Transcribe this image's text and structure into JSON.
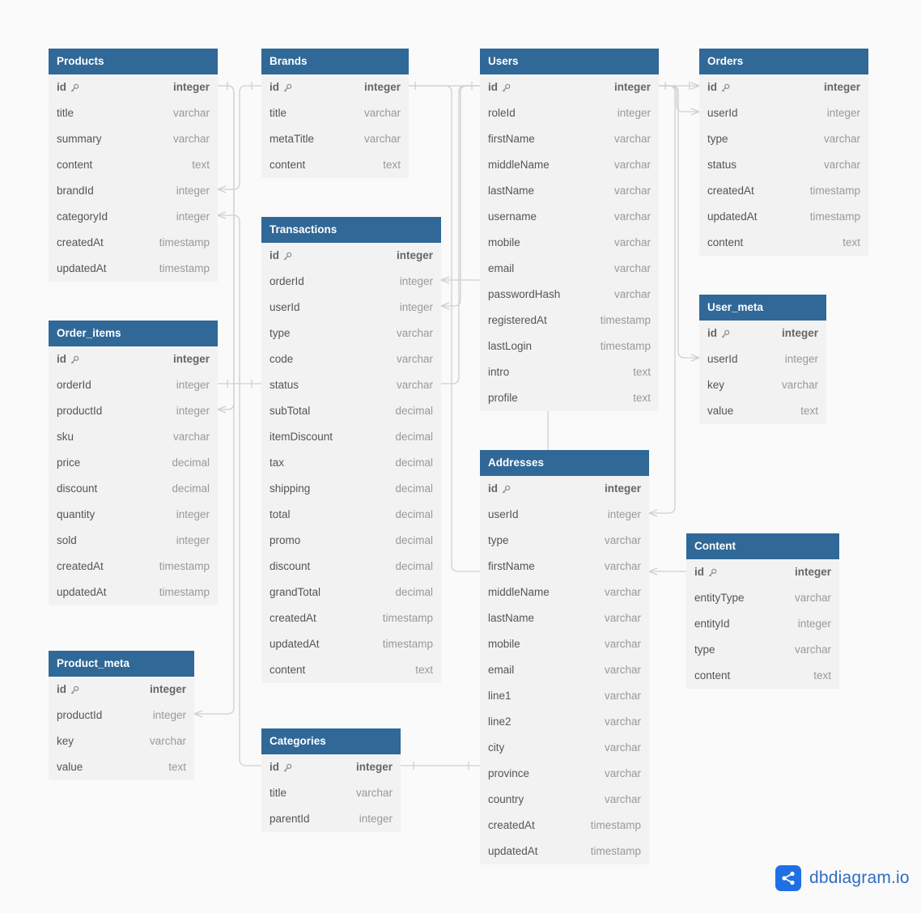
{
  "brand": {
    "name": "dbdiagram.io",
    "icon": "share-nodes-icon",
    "color": "#1f6fe5"
  },
  "colors": {
    "header": "#306897",
    "body": "#f2f2f2",
    "link": "#cfcfcf"
  },
  "tables": [
    {
      "id": "products",
      "name": "Products",
      "fields": [
        {
          "name": "id",
          "type": "integer",
          "pk": true
        },
        {
          "name": "title",
          "type": "varchar"
        },
        {
          "name": "summary",
          "type": "varchar"
        },
        {
          "name": "content",
          "type": "text"
        },
        {
          "name": "brandId",
          "type": "integer"
        },
        {
          "name": "categoryId",
          "type": "integer"
        },
        {
          "name": "createdAt",
          "type": "timestamp"
        },
        {
          "name": "updatedAt",
          "type": "timestamp"
        }
      ]
    },
    {
      "id": "brands",
      "name": "Brands",
      "fields": [
        {
          "name": "id",
          "type": "integer",
          "pk": true
        },
        {
          "name": "title",
          "type": "varchar"
        },
        {
          "name": "metaTitle",
          "type": "varchar"
        },
        {
          "name": "content",
          "type": "text"
        }
      ]
    },
    {
      "id": "users",
      "name": "Users",
      "fields": [
        {
          "name": "id",
          "type": "integer",
          "pk": true
        },
        {
          "name": "roleId",
          "type": "integer"
        },
        {
          "name": "firstName",
          "type": "varchar"
        },
        {
          "name": "middleName",
          "type": "varchar"
        },
        {
          "name": "lastName",
          "type": "varchar"
        },
        {
          "name": "username",
          "type": "varchar"
        },
        {
          "name": "mobile",
          "type": "varchar"
        },
        {
          "name": "email",
          "type": "varchar"
        },
        {
          "name": "passwordHash",
          "type": "varchar"
        },
        {
          "name": "registeredAt",
          "type": "timestamp"
        },
        {
          "name": "lastLogin",
          "type": "timestamp"
        },
        {
          "name": "intro",
          "type": "text"
        },
        {
          "name": "profile",
          "type": "text"
        }
      ]
    },
    {
      "id": "orders",
      "name": "Orders",
      "fields": [
        {
          "name": "id",
          "type": "integer",
          "pk": true
        },
        {
          "name": "userId",
          "type": "integer"
        },
        {
          "name": "type",
          "type": "varchar"
        },
        {
          "name": "status",
          "type": "varchar"
        },
        {
          "name": "createdAt",
          "type": "timestamp"
        },
        {
          "name": "updatedAt",
          "type": "timestamp"
        },
        {
          "name": "content",
          "type": "text"
        }
      ]
    },
    {
      "id": "transactions",
      "name": "Transactions",
      "fields": [
        {
          "name": "id",
          "type": "integer",
          "pk": true
        },
        {
          "name": "orderId",
          "type": "integer"
        },
        {
          "name": "userId",
          "type": "integer"
        },
        {
          "name": "type",
          "type": "varchar"
        },
        {
          "name": "code",
          "type": "varchar"
        },
        {
          "name": "status",
          "type": "varchar"
        },
        {
          "name": "subTotal",
          "type": "decimal"
        },
        {
          "name": "itemDiscount",
          "type": "decimal"
        },
        {
          "name": "tax",
          "type": "decimal"
        },
        {
          "name": "shipping",
          "type": "decimal"
        },
        {
          "name": "total",
          "type": "decimal"
        },
        {
          "name": "promo",
          "type": "decimal"
        },
        {
          "name": "discount",
          "type": "decimal"
        },
        {
          "name": "grandTotal",
          "type": "decimal"
        },
        {
          "name": "createdAt",
          "type": "timestamp"
        },
        {
          "name": "updatedAt",
          "type": "timestamp"
        },
        {
          "name": "content",
          "type": "text"
        }
      ]
    },
    {
      "id": "user_meta",
      "name": "User_meta",
      "fields": [
        {
          "name": "id",
          "type": "integer",
          "pk": true
        },
        {
          "name": "userId",
          "type": "integer"
        },
        {
          "name": "key",
          "type": "varchar"
        },
        {
          "name": "value",
          "type": "text"
        }
      ]
    },
    {
      "id": "order_items",
      "name": "Order_items",
      "fields": [
        {
          "name": "id",
          "type": "integer",
          "pk": true
        },
        {
          "name": "orderId",
          "type": "integer"
        },
        {
          "name": "productId",
          "type": "integer"
        },
        {
          "name": "sku",
          "type": "varchar"
        },
        {
          "name": "price",
          "type": "decimal"
        },
        {
          "name": "discount",
          "type": "decimal"
        },
        {
          "name": "quantity",
          "type": "integer"
        },
        {
          "name": "sold",
          "type": "integer"
        },
        {
          "name": "createdAt",
          "type": "timestamp"
        },
        {
          "name": "updatedAt",
          "type": "timestamp"
        }
      ]
    },
    {
      "id": "addresses",
      "name": "Addresses",
      "fields": [
        {
          "name": "id",
          "type": "integer",
          "pk": true
        },
        {
          "name": "userId",
          "type": "integer"
        },
        {
          "name": "type",
          "type": "varchar"
        },
        {
          "name": "firstName",
          "type": "varchar"
        },
        {
          "name": "middleName",
          "type": "varchar"
        },
        {
          "name": "lastName",
          "type": "varchar"
        },
        {
          "name": "mobile",
          "type": "varchar"
        },
        {
          "name": "email",
          "type": "varchar"
        },
        {
          "name": "line1",
          "type": "varchar"
        },
        {
          "name": "line2",
          "type": "varchar"
        },
        {
          "name": "city",
          "type": "varchar"
        },
        {
          "name": "province",
          "type": "varchar"
        },
        {
          "name": "country",
          "type": "varchar"
        },
        {
          "name": "createdAt",
          "type": "timestamp"
        },
        {
          "name": "updatedAt",
          "type": "timestamp"
        }
      ]
    },
    {
      "id": "content",
      "name": "Content",
      "fields": [
        {
          "name": "id",
          "type": "integer",
          "pk": true
        },
        {
          "name": "entityType",
          "type": "varchar"
        },
        {
          "name": "entityId",
          "type": "integer"
        },
        {
          "name": "type",
          "type": "varchar"
        },
        {
          "name": "content",
          "type": "text"
        }
      ]
    },
    {
      "id": "product_meta",
      "name": "Product_meta",
      "fields": [
        {
          "name": "id",
          "type": "integer",
          "pk": true
        },
        {
          "name": "productId",
          "type": "integer"
        },
        {
          "name": "key",
          "type": "varchar"
        },
        {
          "name": "value",
          "type": "text"
        }
      ]
    },
    {
      "id": "categories",
      "name": "Categories",
      "fields": [
        {
          "name": "id",
          "type": "integer",
          "pk": true
        },
        {
          "name": "title",
          "type": "varchar"
        },
        {
          "name": "parentId",
          "type": "integer"
        }
      ]
    }
  ],
  "relationships": [
    {
      "from": "products.brandId",
      "to": "brands.id"
    },
    {
      "from": "products.categoryId",
      "to": "categories.id"
    },
    {
      "from": "order_items.productId",
      "to": "products.id"
    },
    {
      "from": "product_meta.productId",
      "to": "products.id"
    },
    {
      "from": "order_items.orderId",
      "to": "orders.id"
    },
    {
      "from": "transactions.orderId",
      "to": "orders.id"
    },
    {
      "from": "transactions.userId",
      "to": "users.id"
    },
    {
      "from": "orders.userId",
      "to": "users.id"
    },
    {
      "from": "user_meta.userId",
      "to": "users.id"
    },
    {
      "from": "addresses.userId",
      "to": "users.id"
    },
    {
      "from": "content.id",
      "to": "users.id"
    },
    {
      "from": "categories.id",
      "to": "addresses.id"
    }
  ]
}
